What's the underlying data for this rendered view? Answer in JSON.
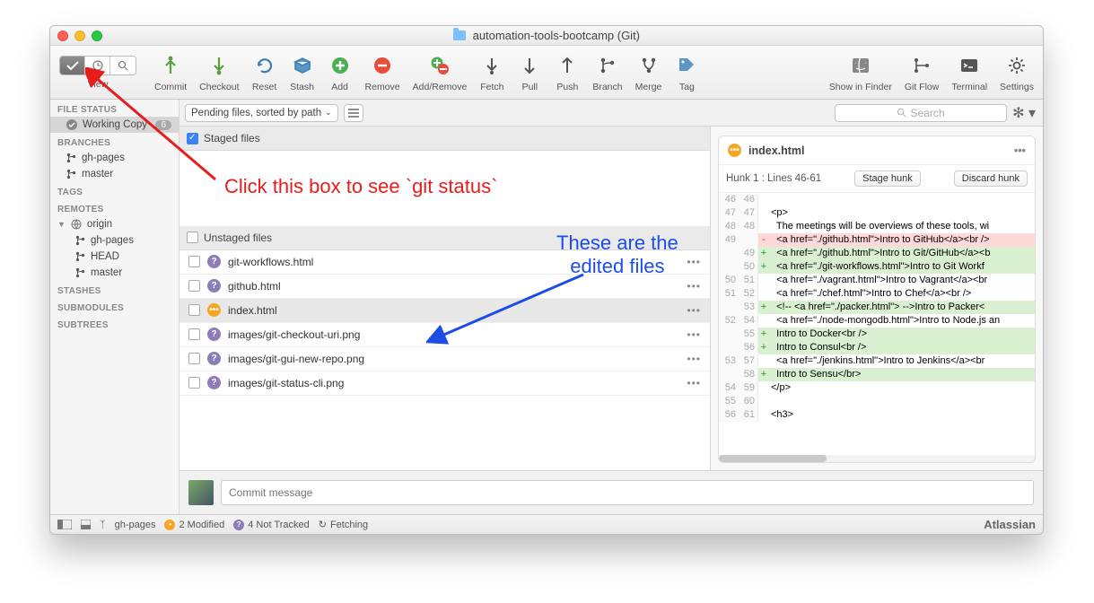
{
  "window": {
    "title": "automation-tools-bootcamp (Git)"
  },
  "toolbar": [
    {
      "k": "commit",
      "label": "Commit"
    },
    {
      "k": "checkout",
      "label": "Checkout"
    },
    {
      "k": "reset",
      "label": "Reset"
    },
    {
      "k": "stash",
      "label": "Stash"
    },
    {
      "k": "add",
      "label": "Add"
    },
    {
      "k": "remove",
      "label": "Remove"
    },
    {
      "k": "addremove",
      "label": "Add/Remove"
    },
    {
      "k": "fetch",
      "label": "Fetch"
    },
    {
      "k": "pull",
      "label": "Pull"
    },
    {
      "k": "push",
      "label": "Push"
    },
    {
      "k": "branch",
      "label": "Branch"
    },
    {
      "k": "merge",
      "label": "Merge"
    },
    {
      "k": "tag",
      "label": "Tag"
    }
  ],
  "toolbar_right": [
    {
      "k": "finder",
      "label": "Show in Finder"
    },
    {
      "k": "gitflow",
      "label": "Git Flow"
    },
    {
      "k": "terminal",
      "label": "Terminal"
    },
    {
      "k": "settings",
      "label": "Settings"
    }
  ],
  "secondary": {
    "sort_dropdown": "Pending files, sorted by path",
    "search_placeholder": "Search"
  },
  "sidebar": {
    "file_status_h": "FILE STATUS",
    "working_copy": "Working Copy",
    "working_copy_badge": "6",
    "branches_h": "BRANCHES",
    "branches": [
      "gh-pages",
      "master"
    ],
    "tags_h": "TAGS",
    "remotes_h": "REMOTES",
    "remote_name": "origin",
    "remote_branches": [
      "gh-pages",
      "HEAD",
      "master"
    ],
    "stashes_h": "STASHES",
    "submodules_h": "SUBMODULES",
    "subtrees_h": "SUBTREES"
  },
  "center": {
    "staged_h": "Staged files",
    "unstaged_h": "Unstaged files",
    "files": [
      {
        "name": "git-workflows.html",
        "kind": "q"
      },
      {
        "name": "github.html",
        "kind": "q"
      },
      {
        "name": "index.html",
        "kind": "m",
        "selected": true
      },
      {
        "name": "images/git-checkout-uri.png",
        "kind": "q"
      },
      {
        "name": "images/git-gui-new-repo.png",
        "kind": "q"
      },
      {
        "name": "images/git-status-cli.png",
        "kind": "q"
      }
    ],
    "commit_placeholder": "Commit message"
  },
  "diff": {
    "file": "index.html",
    "hunk_label": "Hunk 1 : Lines 46-61",
    "stage_btn": "Stage hunk",
    "discard_btn": "Discard hunk",
    "lines": [
      {
        "a": "46",
        "b": "46",
        "s": " ",
        "t": ""
      },
      {
        "a": "47",
        "b": "47",
        "s": " ",
        "t": "<p>"
      },
      {
        "a": "48",
        "b": "48",
        "s": " ",
        "t": "  The meetings will be overviews of these tools, wi"
      },
      {
        "a": "49",
        "b": "",
        "s": "-",
        "t": "  <a href=\"./github.html\">Intro to GitHub</a><br />"
      },
      {
        "a": "",
        "b": "49",
        "s": "+",
        "t": "  <a href=\"./github.html\">Intro to Git/GitHub</a><b"
      },
      {
        "a": "",
        "b": "50",
        "s": "+",
        "t": "  <a href=\"./git-workflows.html\">Intro to Git Workf"
      },
      {
        "a": "50",
        "b": "51",
        "s": " ",
        "t": "  <a href=\"./vagrant.html\">Intro to Vagrant</a><br "
      },
      {
        "a": "51",
        "b": "52",
        "s": " ",
        "t": "  <a href=\"./chef.html\">Intro to Chef</a><br />"
      },
      {
        "a": "",
        "b": "53",
        "s": "+",
        "t": "  <!-- <a href=\"./packer.html\"> -->Intro to Packer<"
      },
      {
        "a": "52",
        "b": "54",
        "s": " ",
        "t": "  <a href=\"./node-mongodb.html\">Intro to Node.js an"
      },
      {
        "a": "",
        "b": "55",
        "s": "+",
        "t": "  Intro to Docker<br />"
      },
      {
        "a": "",
        "b": "56",
        "s": "+",
        "t": "  Intro to Consul<br />"
      },
      {
        "a": "53",
        "b": "57",
        "s": " ",
        "t": "  <a href=\"./jenkins.html\">Intro to Jenkins</a><br "
      },
      {
        "a": "",
        "b": "58",
        "s": "+",
        "t": "  Intro to Sensu</br>"
      },
      {
        "a": "54",
        "b": "59",
        "s": " ",
        "t": "</p>"
      },
      {
        "a": "55",
        "b": "60",
        "s": " ",
        "t": ""
      },
      {
        "a": "56",
        "b": "61",
        "s": " ",
        "t": "<h3>"
      }
    ]
  },
  "status": {
    "branch": "gh-pages",
    "modified": "2 Modified",
    "nottracked": "4 Not Tracked",
    "fetching": "Fetching",
    "brand": "Atlassian"
  },
  "annotations": {
    "a1": "Click this box to see `git status`",
    "a2_l1": "These are the",
    "a2_l2": "edited files"
  }
}
